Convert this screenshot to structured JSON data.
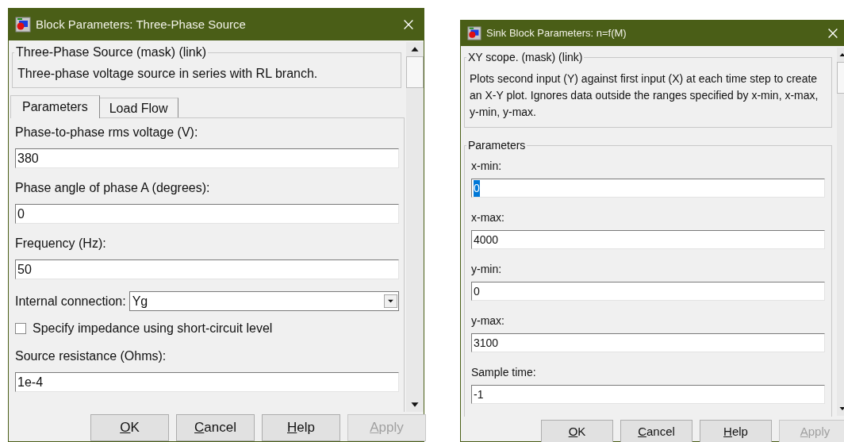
{
  "dialogs": [
    {
      "title": "Block Parameters: Three-Phase Source",
      "description_group": {
        "title": "Three-Phase Source (mask) (link)",
        "text": "Three-phase voltage source in series with RL branch."
      },
      "tabs": [
        {
          "label": "Parameters",
          "selected": true
        },
        {
          "label": "Load Flow",
          "selected": false
        }
      ],
      "parameters": [
        {
          "kind": "text",
          "label": "Phase-to-phase rms voltage (V):",
          "value": "380"
        },
        {
          "kind": "text",
          "label": "Phase angle of phase A (degrees):",
          "value": "0"
        },
        {
          "kind": "text",
          "label": "Frequency (Hz):",
          "value": "50"
        },
        {
          "kind": "dropdown",
          "label": "Internal connection:",
          "value": "Yg"
        },
        {
          "kind": "checkbox",
          "label": "Specify impedance using short-circuit level",
          "checked": false
        },
        {
          "kind": "text",
          "label": "Source resistance (Ohms):",
          "value": "1e-4"
        }
      ],
      "buttons": [
        {
          "label_parts": [
            {
              "text": "O",
              "underlined": true
            },
            {
              "text": "K",
              "underlined": false
            }
          ],
          "disabled": false
        },
        {
          "label_parts": [
            {
              "text": "C",
              "underlined": true
            },
            {
              "text": "ancel",
              "underlined": false
            }
          ],
          "disabled": false
        },
        {
          "label_parts": [
            {
              "text": "H",
              "underlined": true
            },
            {
              "text": "elp",
              "underlined": false
            }
          ],
          "disabled": false
        },
        {
          "label_parts": [
            {
              "text": "A",
              "underlined": true
            },
            {
              "text": "pply",
              "underlined": false
            }
          ],
          "disabled": true
        }
      ]
    },
    {
      "title": "Sink Block Parameters: n=f(M)",
      "description_group": {
        "title": "XY scope. (mask) (link)",
        "text": "Plots second input (Y) against first input (X) at each time step to  create an X-Y plot. Ignores data outside the ranges specified by x-min, x-max, y-min, y-max."
      },
      "parameters_group": {
        "title": "Parameters"
      },
      "parameters": [
        {
          "kind": "text",
          "label": "x-min:",
          "value": "0",
          "text_selected": true
        },
        {
          "kind": "text",
          "label": "x-max:",
          "value": "4000",
          "text_selected": false
        },
        {
          "kind": "text",
          "label": "y-min:",
          "value": "0",
          "text_selected": false
        },
        {
          "kind": "text",
          "label": "y-max:",
          "value": "3100",
          "text_selected": false
        },
        {
          "kind": "text",
          "label": "Sample time:",
          "value": "-1",
          "text_selected": false
        }
      ],
      "buttons": [
        {
          "label_parts": [
            {
              "text": "O",
              "underlined": true
            },
            {
              "text": "K",
              "underlined": false
            }
          ],
          "disabled": false
        },
        {
          "label_parts": [
            {
              "text": "C",
              "underlined": true
            },
            {
              "text": "ancel",
              "underlined": false
            }
          ],
          "disabled": false
        },
        {
          "label_parts": [
            {
              "text": "H",
              "underlined": true
            },
            {
              "text": "elp",
              "underlined": false
            }
          ],
          "disabled": false
        },
        {
          "label_parts": [
            {
              "text": "A",
              "underlined": true
            },
            {
              "text": "pply",
              "underlined": false
            }
          ],
          "disabled": true
        }
      ]
    }
  ]
}
